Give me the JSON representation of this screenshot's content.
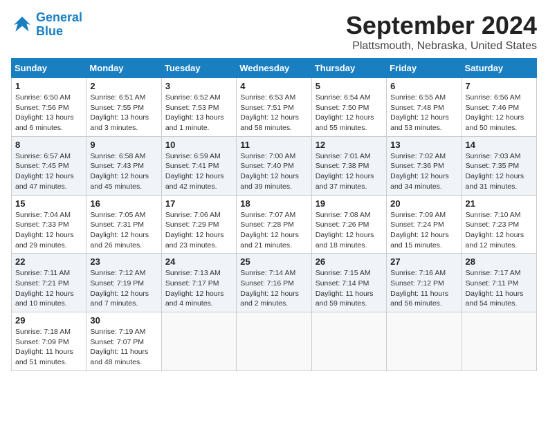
{
  "logo": {
    "line1": "General",
    "line2": "Blue"
  },
  "title": "September 2024",
  "location": "Plattsmouth, Nebraska, United States",
  "days_of_week": [
    "Sunday",
    "Monday",
    "Tuesday",
    "Wednesday",
    "Thursday",
    "Friday",
    "Saturday"
  ],
  "weeks": [
    [
      {
        "day": "1",
        "sunrise": "6:50 AM",
        "sunset": "7:56 PM",
        "daylight": "13 hours and 6 minutes."
      },
      {
        "day": "2",
        "sunrise": "6:51 AM",
        "sunset": "7:55 PM",
        "daylight": "13 hours and 3 minutes."
      },
      {
        "day": "3",
        "sunrise": "6:52 AM",
        "sunset": "7:53 PM",
        "daylight": "13 hours and 1 minute."
      },
      {
        "day": "4",
        "sunrise": "6:53 AM",
        "sunset": "7:51 PM",
        "daylight": "12 hours and 58 minutes."
      },
      {
        "day": "5",
        "sunrise": "6:54 AM",
        "sunset": "7:50 PM",
        "daylight": "12 hours and 55 minutes."
      },
      {
        "day": "6",
        "sunrise": "6:55 AM",
        "sunset": "7:48 PM",
        "daylight": "12 hours and 53 minutes."
      },
      {
        "day": "7",
        "sunrise": "6:56 AM",
        "sunset": "7:46 PM",
        "daylight": "12 hours and 50 minutes."
      }
    ],
    [
      {
        "day": "8",
        "sunrise": "6:57 AM",
        "sunset": "7:45 PM",
        "daylight": "12 hours and 47 minutes."
      },
      {
        "day": "9",
        "sunrise": "6:58 AM",
        "sunset": "7:43 PM",
        "daylight": "12 hours and 45 minutes."
      },
      {
        "day": "10",
        "sunrise": "6:59 AM",
        "sunset": "7:41 PM",
        "daylight": "12 hours and 42 minutes."
      },
      {
        "day": "11",
        "sunrise": "7:00 AM",
        "sunset": "7:40 PM",
        "daylight": "12 hours and 39 minutes."
      },
      {
        "day": "12",
        "sunrise": "7:01 AM",
        "sunset": "7:38 PM",
        "daylight": "12 hours and 37 minutes."
      },
      {
        "day": "13",
        "sunrise": "7:02 AM",
        "sunset": "7:36 PM",
        "daylight": "12 hours and 34 minutes."
      },
      {
        "day": "14",
        "sunrise": "7:03 AM",
        "sunset": "7:35 PM",
        "daylight": "12 hours and 31 minutes."
      }
    ],
    [
      {
        "day": "15",
        "sunrise": "7:04 AM",
        "sunset": "7:33 PM",
        "daylight": "12 hours and 29 minutes."
      },
      {
        "day": "16",
        "sunrise": "7:05 AM",
        "sunset": "7:31 PM",
        "daylight": "12 hours and 26 minutes."
      },
      {
        "day": "17",
        "sunrise": "7:06 AM",
        "sunset": "7:29 PM",
        "daylight": "12 hours and 23 minutes."
      },
      {
        "day": "18",
        "sunrise": "7:07 AM",
        "sunset": "7:28 PM",
        "daylight": "12 hours and 21 minutes."
      },
      {
        "day": "19",
        "sunrise": "7:08 AM",
        "sunset": "7:26 PM",
        "daylight": "12 hours and 18 minutes."
      },
      {
        "day": "20",
        "sunrise": "7:09 AM",
        "sunset": "7:24 PM",
        "daylight": "12 hours and 15 minutes."
      },
      {
        "day": "21",
        "sunrise": "7:10 AM",
        "sunset": "7:23 PM",
        "daylight": "12 hours and 12 minutes."
      }
    ],
    [
      {
        "day": "22",
        "sunrise": "7:11 AM",
        "sunset": "7:21 PM",
        "daylight": "12 hours and 10 minutes."
      },
      {
        "day": "23",
        "sunrise": "7:12 AM",
        "sunset": "7:19 PM",
        "daylight": "12 hours and 7 minutes."
      },
      {
        "day": "24",
        "sunrise": "7:13 AM",
        "sunset": "7:17 PM",
        "daylight": "12 hours and 4 minutes."
      },
      {
        "day": "25",
        "sunrise": "7:14 AM",
        "sunset": "7:16 PM",
        "daylight": "12 hours and 2 minutes."
      },
      {
        "day": "26",
        "sunrise": "7:15 AM",
        "sunset": "7:14 PM",
        "daylight": "11 hours and 59 minutes."
      },
      {
        "day": "27",
        "sunrise": "7:16 AM",
        "sunset": "7:12 PM",
        "daylight": "11 hours and 56 minutes."
      },
      {
        "day": "28",
        "sunrise": "7:17 AM",
        "sunset": "7:11 PM",
        "daylight": "11 hours and 54 minutes."
      }
    ],
    [
      {
        "day": "29",
        "sunrise": "7:18 AM",
        "sunset": "7:09 PM",
        "daylight": "11 hours and 51 minutes."
      },
      {
        "day": "30",
        "sunrise": "7:19 AM",
        "sunset": "7:07 PM",
        "daylight": "11 hours and 48 minutes."
      },
      null,
      null,
      null,
      null,
      null
    ]
  ]
}
